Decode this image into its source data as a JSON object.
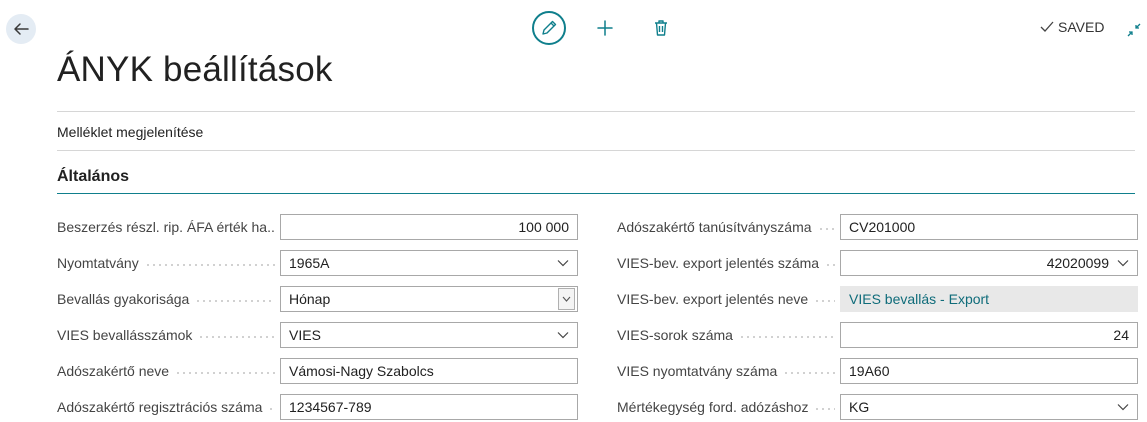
{
  "toolbar": {
    "saved_label": "SAVED"
  },
  "page": {
    "title": "ÁNYK beállítások"
  },
  "actions": {
    "attachment_link": "Melléklet megjelenítése"
  },
  "section": {
    "title": "Általános"
  },
  "fields_left": [
    {
      "label": "Beszerzés részl. rip. ÁFA érték ha...",
      "value": "100 000",
      "kind": "number"
    },
    {
      "label": "Nyomtatvány",
      "value": "1965A",
      "kind": "dropdown"
    },
    {
      "label": "Bevallás gyakorisága",
      "value": "Hónap",
      "kind": "select"
    },
    {
      "label": "VIES bevallásszámok",
      "value": "VIES",
      "kind": "dropdown"
    },
    {
      "label": "Adószakértő neve",
      "value": "Vámosi-Nagy Szabolcs",
      "kind": "text"
    },
    {
      "label": "Adószakértő regisztrációs száma",
      "value": "1234567-789",
      "kind": "text"
    }
  ],
  "fields_right": [
    {
      "label": "Adószakértő tanúsítványszáma",
      "value": "CV201000",
      "kind": "text"
    },
    {
      "label": "VIES-bev. export jelentés száma",
      "value": "42020099",
      "kind": "dropdown-number"
    },
    {
      "label": "VIES-bev. export jelentés neve",
      "value": "VIES bevallás - Export",
      "kind": "readonly"
    },
    {
      "label": "VIES-sorok száma",
      "value": "24",
      "kind": "number"
    },
    {
      "label": "VIES nyomtatvány száma",
      "value": "19A60",
      "kind": "text"
    },
    {
      "label": "Mértékegység ford. adózáshoz",
      "value": "KG",
      "kind": "dropdown"
    }
  ],
  "colors": {
    "accent": "#0f7f8c",
    "link": "#0f6c7a",
    "readonly_bg": "#e8e8e8"
  },
  "icons": [
    "back-arrow-icon",
    "pencil-icon",
    "plus-icon",
    "trash-icon",
    "checkmark-icon",
    "collapse-icon",
    "chevron-down-icon"
  ]
}
